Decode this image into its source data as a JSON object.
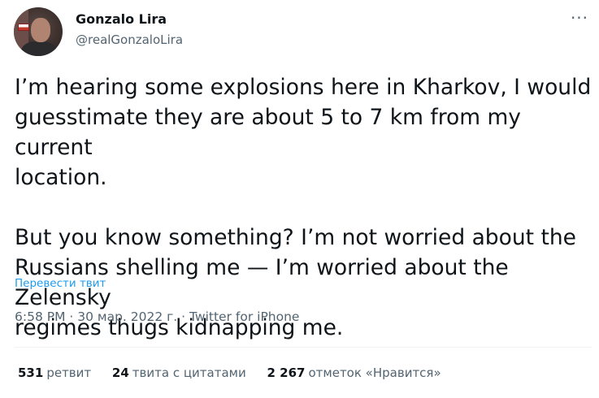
{
  "author": {
    "name": "Gonzalo Lira",
    "handle": "@realGonzaloLira"
  },
  "more_icon": "more-horizontal-icon",
  "tweet": {
    "paragraph1_line1": "I’m hearing some explosions here in Kharkov, I would",
    "paragraph1_line2": "guesstimate they are about 5 to 7 km from my current",
    "paragraph1_line3": "location.",
    "paragraph2_line1": "But you know something? I’m not worried about the",
    "paragraph2_line2": "Russians shelling me — I’m worried about the Zelensky",
    "paragraph2_line3": "regimes thugs kidnapping me.",
    "translate_label": "Перевести твит"
  },
  "meta": {
    "time": "6:58 PM",
    "sep1": " · ",
    "date": "30 мар. 2022 г.",
    "sep2": " · ",
    "source": "Twitter for iPhone"
  },
  "stats": {
    "retweets_count": "531",
    "retweets_label": "ретвит",
    "quotes_count": "24",
    "quotes_label": "твита с цитатами",
    "likes_count": "2 267",
    "likes_label": "отметок «Нравится»"
  },
  "colors": {
    "text": "#0f1419",
    "secondary": "#536471",
    "link": "#1d9bf0"
  }
}
